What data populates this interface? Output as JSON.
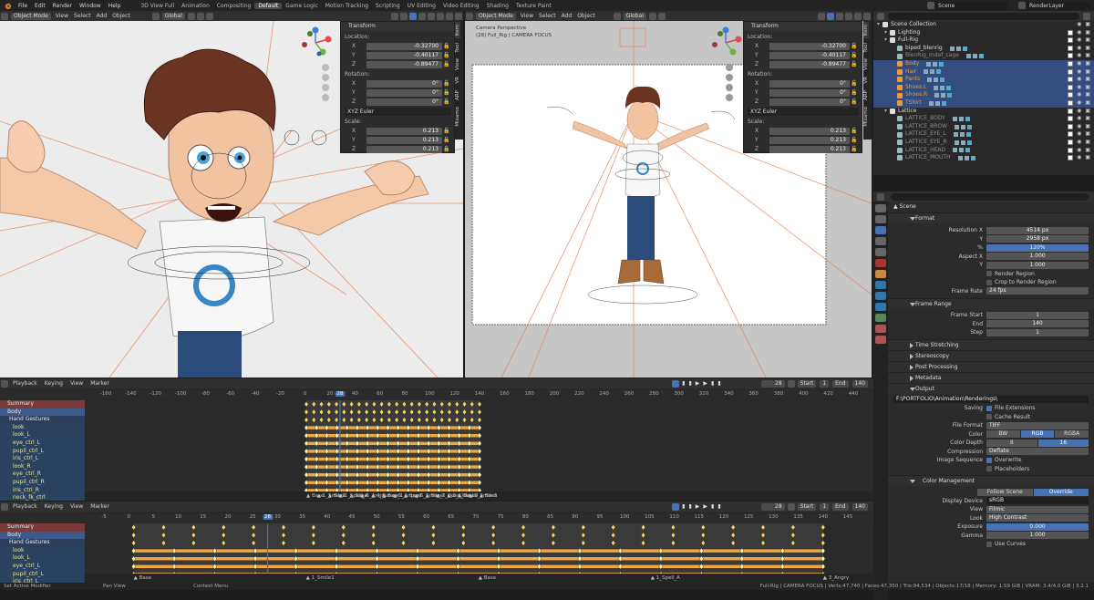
{
  "topbar": {
    "menus": [
      "File",
      "Edit",
      "Render",
      "Window",
      "Help"
    ],
    "workspaces": [
      "3D View Full",
      "Animation",
      "Compositing",
      "Default",
      "Game Logic",
      "Motion Tracking",
      "Scripting",
      "UV Editing",
      "Video Editing",
      "Shading",
      "Texture Paint"
    ],
    "active_workspace": "Default",
    "scene": "Scene",
    "view_layer": "RenderLayer"
  },
  "viewport_left": {
    "mode": "Object Mode",
    "menus": [
      "View",
      "Select",
      "Add",
      "Object"
    ],
    "orientation": "Global",
    "tabs": [
      "Item",
      "Tool",
      "View",
      "VR",
      "ARP",
      "Mixamo"
    ]
  },
  "viewport_right": {
    "mode": "Object Mode",
    "menus": [
      "View",
      "Select",
      "Add",
      "Object"
    ],
    "orientation": "Global",
    "camera_label": "Camera Perspective",
    "camera_sub": "(28) Full_Rig | CAMERA FOCUS",
    "tabs": [
      "Item",
      "Tool",
      "View",
      "VR",
      "ARP",
      "Mixamo"
    ]
  },
  "transform": {
    "title": "Transform",
    "location_label": "Location:",
    "location": [
      {
        "k": "X",
        "v": "-0.32700"
      },
      {
        "k": "Y",
        "v": "-0.40117"
      },
      {
        "k": "Z",
        "v": "-0.89477"
      }
    ],
    "rotation_label": "Rotation:",
    "rotation": [
      {
        "k": "X",
        "v": "0°"
      },
      {
        "k": "Y",
        "v": "0°"
      },
      {
        "k": "Z",
        "v": "0°"
      }
    ],
    "rotation_mode": "XYZ Euler",
    "scale_label": "Scale:",
    "scale": [
      {
        "k": "X",
        "v": "0.213"
      },
      {
        "k": "Y",
        "v": "0.213"
      },
      {
        "k": "Z",
        "v": "0.213"
      }
    ]
  },
  "outliner": {
    "rows": [
      {
        "name": "Scene Collection",
        "indent": 0,
        "style": "",
        "sel": false
      },
      {
        "name": "Lighting",
        "indent": 1,
        "style": "",
        "sel": false
      },
      {
        "name": "Full-Rig",
        "indent": 1,
        "style": "",
        "sel": false
      },
      {
        "name": "biped_blenrig",
        "indent": 2,
        "style": "",
        "sel": false
      },
      {
        "name": "BlenRig_mdef_cage",
        "indent": 2,
        "style": "dim",
        "sel": false
      },
      {
        "name": "Body",
        "indent": 2,
        "style": "orange",
        "sel": true
      },
      {
        "name": "Hair",
        "indent": 2,
        "style": "orange",
        "sel": true
      },
      {
        "name": "Pants",
        "indent": 2,
        "style": "orange",
        "sel": true
      },
      {
        "name": "Shoes.L",
        "indent": 2,
        "style": "orange",
        "sel": true
      },
      {
        "name": "Shoes.R",
        "indent": 2,
        "style": "orange",
        "sel": true
      },
      {
        "name": "TShirt",
        "indent": 2,
        "style": "orange",
        "sel": true
      },
      {
        "name": "Lattice",
        "indent": 1,
        "style": "",
        "sel": false
      },
      {
        "name": "LATTICE_BODY",
        "indent": 2,
        "style": "dim",
        "sel": false
      },
      {
        "name": "LATTICE_BROW",
        "indent": 2,
        "style": "dim",
        "sel": false
      },
      {
        "name": "LATTICE_EYE_L",
        "indent": 2,
        "style": "dim",
        "sel": false
      },
      {
        "name": "LATTICE_EYE_R",
        "indent": 2,
        "style": "dim",
        "sel": false
      },
      {
        "name": "LATTICE_HEAD",
        "indent": 2,
        "style": "dim",
        "sel": false
      },
      {
        "name": "LATTICE_MOUTH",
        "indent": 2,
        "style": "dim",
        "sel": false
      }
    ]
  },
  "properties": {
    "context": "Scene",
    "format": {
      "title": "Format",
      "resx_label": "Resolution X",
      "resx": "4514 px",
      "resy_label": "Y",
      "resy": "2958 px",
      "pct_label": "%",
      "pct": "120%",
      "aspx_label": "Aspect X",
      "aspx": "1.000",
      "aspy_label": "Y",
      "aspy": "1.000",
      "render_region": "Render Region",
      "crop": "Crop to Render Region",
      "fps_label": "Frame Rate",
      "fps": "24 fps"
    },
    "frame_range": {
      "title": "Frame Range",
      "start_label": "Frame Start",
      "start": "1",
      "end_label": "End",
      "end": "140",
      "step_label": "Step",
      "step": "1"
    },
    "time_stretching": "Time Stretching",
    "stereoscopy": "Stereoscopy",
    "post_processing": "Post Processing",
    "metadata": "Metadata",
    "output": {
      "title": "Output",
      "path": "F:\\PORTFOLIO\\Animation\\Renderings\\",
      "saving_label": "Saving",
      "file_ext": "File Extensions",
      "cache_result": "Cache Result",
      "format_label": "File Format",
      "format": "TIFF",
      "color_label": "Color",
      "color_opts": [
        "BW",
        "RGB",
        "RGBA"
      ],
      "color_sel": "RGB",
      "depth_label": "Color Depth",
      "depth_opts": [
        "8",
        "16"
      ],
      "depth_sel": "16",
      "compression_label": "Compression",
      "compression": "Deflate",
      "image_seq_label": "Image Sequence",
      "overwrite": "Overwrite",
      "placeholders": "Placeholders"
    },
    "color_management": {
      "title": "Color Management",
      "opts": [
        "Follow Scene",
        "Override"
      ],
      "sel": "Override",
      "display_label": "Display Device",
      "display": "sRGB",
      "view_label": "View",
      "view": "Filmic",
      "look_label": "Look",
      "look": "High Contrast",
      "exposure_label": "Exposure",
      "exposure": "0.000",
      "gamma_label": "Gamma",
      "gamma": "1.000",
      "curves": "Use Curves"
    }
  },
  "dopesheet_top": {
    "menus": [
      "Playback",
      "Keying",
      "View",
      "Marker"
    ],
    "current_frame": "28",
    "start_label": "Start",
    "start": "1",
    "end_label": "End",
    "end": "140",
    "ruler": [
      "-160",
      "-140",
      "-120",
      "-100",
      "-80",
      "-60",
      "-40",
      "-20",
      "0",
      "20",
      "28",
      "40",
      "60",
      "80",
      "100",
      "120",
      "140",
      "160",
      "180",
      "200",
      "220",
      "240",
      "260",
      "280",
      "300",
      "320",
      "340",
      "360",
      "380",
      "400",
      "420",
      "440"
    ],
    "channels": [
      {
        "name": "Summary",
        "type": "sum"
      },
      {
        "name": "Body",
        "type": "obj"
      },
      {
        "name": "Hand Gestures",
        "type": "grp"
      },
      {
        "name": "look",
        "type": "bone"
      },
      {
        "name": "look_L",
        "type": "bone"
      },
      {
        "name": "eye_ctrl_L",
        "type": "bone"
      },
      {
        "name": "pupil_ctrl_L",
        "type": "bone"
      },
      {
        "name": "iris_ctrl_L",
        "type": "bone"
      },
      {
        "name": "look_R",
        "type": "bone"
      },
      {
        "name": "eye_ctrl_R",
        "type": "bone"
      },
      {
        "name": "pupil_ctrl_R",
        "type": "bone"
      },
      {
        "name": "iris_ctrl_R",
        "type": "bone"
      },
      {
        "name": "neck_fk_ctrl",
        "type": "bone"
      }
    ],
    "markers": [
      "Base",
      "1_Smile1",
      "Base",
      "1_Spell_A",
      "Base",
      "3_Angry",
      "4_Funny_1",
      "Base",
      "5_Angry2",
      "Base",
      "6_Smile_2",
      "Base",
      "7_Open_LU",
      "8_CloseLU",
      "Base",
      "9_Smile3",
      "Base"
    ]
  },
  "dopesheet_bottom": {
    "menus": [
      "Playback",
      "Keying",
      "View",
      "Marker"
    ],
    "current_frame": "28",
    "start_label": "Start",
    "start": "1",
    "end_label": "End",
    "end": "140",
    "ruler": [
      "-5",
      "0",
      "5",
      "10",
      "15",
      "20",
      "25",
      "28",
      "30",
      "35",
      "40",
      "45",
      "50",
      "55",
      "60",
      "65",
      "70",
      "75",
      "80",
      "85",
      "90",
      "95",
      "100",
      "105",
      "110",
      "115",
      "120",
      "125",
      "130",
      "135",
      "140",
      "145"
    ],
    "channels": [
      {
        "name": "Summary",
        "type": "sum"
      },
      {
        "name": "Body",
        "type": "obj"
      },
      {
        "name": "Hand Gestures",
        "type": "grp"
      },
      {
        "name": "look",
        "type": "bone"
      },
      {
        "name": "look_L",
        "type": "bone"
      },
      {
        "name": "eye_ctrl_L",
        "type": "bone"
      },
      {
        "name": "pupil_ctrl_L",
        "type": "bone"
      },
      {
        "name": "iris_ctrl_L",
        "type": "bone"
      }
    ],
    "markers": [
      "Base",
      "1_Smile1",
      "Base",
      "1_Spell_A",
      "3_Angry"
    ]
  },
  "statusbar": {
    "left": "Set Active Modifier",
    "mid1": "Pan View",
    "mid2": "Context Menu",
    "right": "Full-Rig | CAMERA FOCUS | Verts:47,740 | Faces:47,350 | Tris:94,534 | Objects:17/18 | Memory: 1.59 GiB | VRAM: 3.4/4.0 GiB | 3.2.1"
  },
  "colors": {
    "accent": "#4772b3",
    "orange": "#ee9a3a",
    "keyframe_fill": "#f2a93b",
    "selected_row": "#334d80"
  }
}
